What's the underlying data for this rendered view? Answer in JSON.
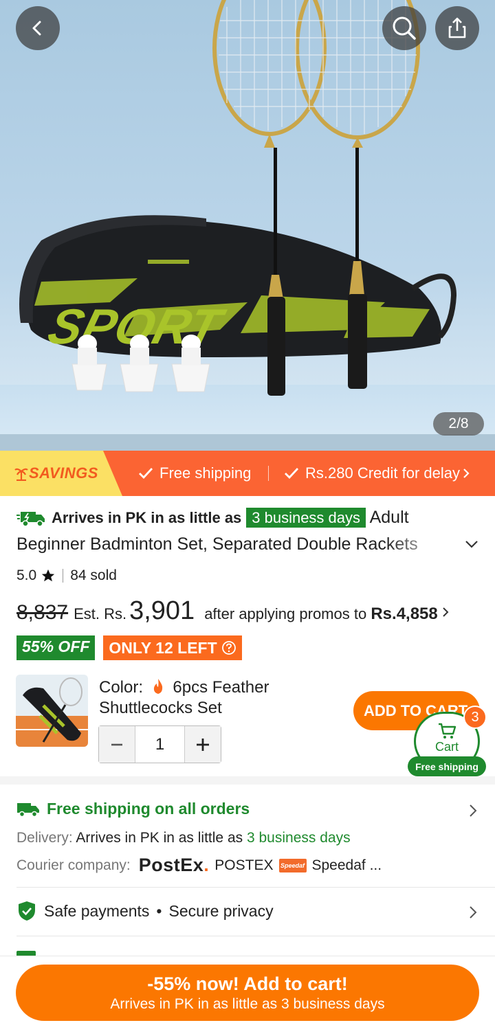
{
  "hero": {
    "image_counter": "2/8",
    "back_icon": "back-arrow-icon",
    "search_icon": "search-icon",
    "share_icon": "share-icon"
  },
  "promo_strip": {
    "savings_label": "SAVINGS",
    "free_shipping": "Free shipping",
    "credit": "Rs.280 Credit for delay"
  },
  "product": {
    "arrives_prefix": "Arrives in PK in as little as",
    "arrives_badge": "3 business days",
    "title": "Adult Beginner Badminton Set, Separated Double Rackets",
    "rating": "5.0",
    "sold": "84 sold",
    "old_price": "8,837",
    "est_label": "Est. Rs.",
    "price": "3,901",
    "after_promo": "after applying promos to",
    "promo_price": "Rs.4,858",
    "discount_tag": "55% OFF",
    "stock_tag": "ONLY 12 LEFT"
  },
  "sku": {
    "color_label": "Color:",
    "color_value": "6pcs Feather Shuttlecocks Set",
    "quantity": "1",
    "add_to_cart": "ADD TO CART",
    "cart_label": "Cart",
    "cart_count": "3",
    "cart_ship": "Free shipping"
  },
  "shipping": {
    "title": "Free shipping on all orders",
    "delivery_label": "Delivery:",
    "delivery_text": "Arrives in PK in as little as",
    "delivery_days": "3 business days",
    "courier_label": "Courier company:",
    "postex_logo": "PostEx",
    "courier_1": "POSTEX",
    "speedaf_logo": "Speedaf",
    "courier_2": "Speedaf ..."
  },
  "safety": {
    "safe_payments": "Safe payments",
    "secure_privacy": "Secure privacy"
  },
  "bottom_cta": {
    "line1": "-55% now! Add to cart!",
    "line2": "Arrives in PK in as little as 3 business days"
  },
  "colors": {
    "orange": "#fb7701",
    "strip_orange": "#fb6433",
    "green": "#1f8a2e",
    "savings_yellow": "#fbe064"
  }
}
